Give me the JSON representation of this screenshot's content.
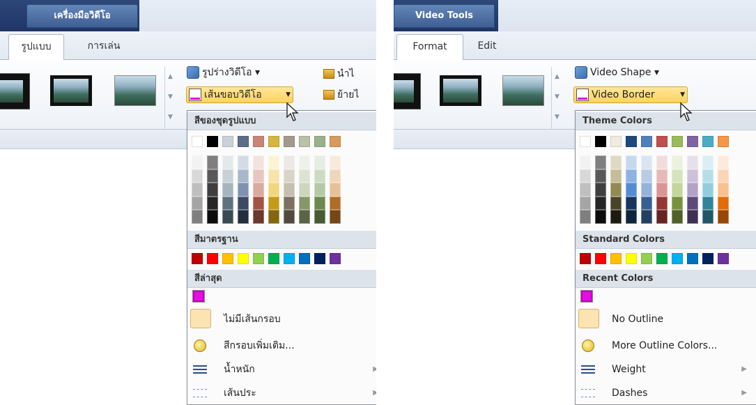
{
  "left": {
    "contextual_tab": "เครื่องมือวิดีโอ",
    "tabs": [
      "รูปแบบ",
      "การเล่น"
    ],
    "shape_btn": "รูปร่างวิดีโอ ▾",
    "border_btn": "เส้นขอบวิดีโอ",
    "right_btn_1": "นำไ",
    "right_btn_2": "ย้ายไ",
    "theme_header": "สีของชุดรูปแบบ",
    "standard_header": "สีมาตรฐาน",
    "recent_header": "สีล่าสุด",
    "no_outline": "ไม่มีเส้นกรอบ",
    "more_colors": "สีกรอบเพิ่มเติม...",
    "weight": "น้ำหนัก",
    "dashes": "เส้นประ"
  },
  "right": {
    "contextual_tab": "Video Tools",
    "tabs": [
      "Format",
      "Edit"
    ],
    "shape_btn": "Video Shape ▾",
    "border_btn": "Video Border",
    "theme_header": "Theme Colors",
    "standard_header": "Standard Colors",
    "recent_header": "Recent Colors",
    "no_outline": "No Outline",
    "more_colors": "More Outline Colors...",
    "weight": "Weight",
    "dashes": "Dashes"
  },
  "colors": {
    "theme_top": [
      "#ffffff",
      "#000000",
      "#eeece1",
      "#1f497d",
      "#4f81bd",
      "#c0504d",
      "#9bbb59",
      "#8064a2",
      "#4bacc6",
      "#f79646"
    ],
    "theme_columns": [
      [
        "#f2f2f2",
        "#d8d8d8",
        "#bfbfbf",
        "#a5a5a5",
        "#7f7f7f"
      ],
      [
        "#7f7f7f",
        "#595959",
        "#3f3f3f",
        "#262626",
        "#0c0c0c"
      ],
      [
        "#ddd9c3",
        "#c4bd97",
        "#938953",
        "#494429",
        "#1d1b10"
      ],
      [
        "#c6d9f0",
        "#8db3e2",
        "#548dd4",
        "#17365d",
        "#0f243e"
      ],
      [
        "#dbe5f1",
        "#b8cce4",
        "#95b3d7",
        "#366092",
        "#244061"
      ],
      [
        "#f2dcdb",
        "#e5b9b7",
        "#d99694",
        "#953734",
        "#632423"
      ],
      [
        "#ebf1dd",
        "#d7e3bc",
        "#c3d69b",
        "#76923c",
        "#4f6128"
      ],
      [
        "#e5e0ec",
        "#ccc1d9",
        "#b2a2c7",
        "#5f497a",
        "#3f3151"
      ],
      [
        "#dbeef3",
        "#b7dde8",
        "#92cddc",
        "#31859b",
        "#205867"
      ],
      [
        "#fdeada",
        "#fbd5b5",
        "#fac08f",
        "#e36c09",
        "#974806"
      ]
    ],
    "left_theme_top": [
      "#ffffff",
      "#000000",
      "#c9d2d8",
      "#5a6f86",
      "#c98478",
      "#d6b53d",
      "#a39a8c",
      "#b8c2a6",
      "#9cb08c",
      "#d99a5a"
    ],
    "left_theme_columns": [
      [
        "#f2f2f2",
        "#d8d8d8",
        "#bfbfbf",
        "#a5a5a5",
        "#7f7f7f"
      ],
      [
        "#7f7f7f",
        "#595959",
        "#3f3f3f",
        "#262626",
        "#0c0c0c"
      ],
      [
        "#e3e8eb",
        "#c8d1d7",
        "#a6b4bd",
        "#5e727f",
        "#3a4a54"
      ],
      [
        "#d4dbe5",
        "#a9b7cb",
        "#7f93b1",
        "#3b4b63",
        "#232f3f"
      ],
      [
        "#f2e3df",
        "#e5c7bf",
        "#d9aa9f",
        "#a35444",
        "#6c372c"
      ],
      [
        "#fbf3d4",
        "#f6e4a8",
        "#f2d57d",
        "#c79a16",
        "#84660e"
      ],
      [
        "#ece9e4",
        "#d9d4c9",
        "#c6bfae",
        "#7c7160",
        "#524a3f"
      ],
      [
        "#eef1e9",
        "#dde3d3",
        "#ccd6bd",
        "#869868",
        "#596546"
      ],
      [
        "#e6ede1",
        "#cddbc3",
        "#b4c9a5",
        "#6a8a4d",
        "#465b33"
      ],
      [
        "#f7eadd",
        "#efd5bb",
        "#e7c099",
        "#b06b25",
        "#754718"
      ]
    ],
    "standard": [
      "#c00000",
      "#ff0000",
      "#ffc000",
      "#ffff00",
      "#92d050",
      "#00b050",
      "#00b0f0",
      "#0070c0",
      "#002060",
      "#7030a0"
    ],
    "recent": "#e010e0"
  }
}
